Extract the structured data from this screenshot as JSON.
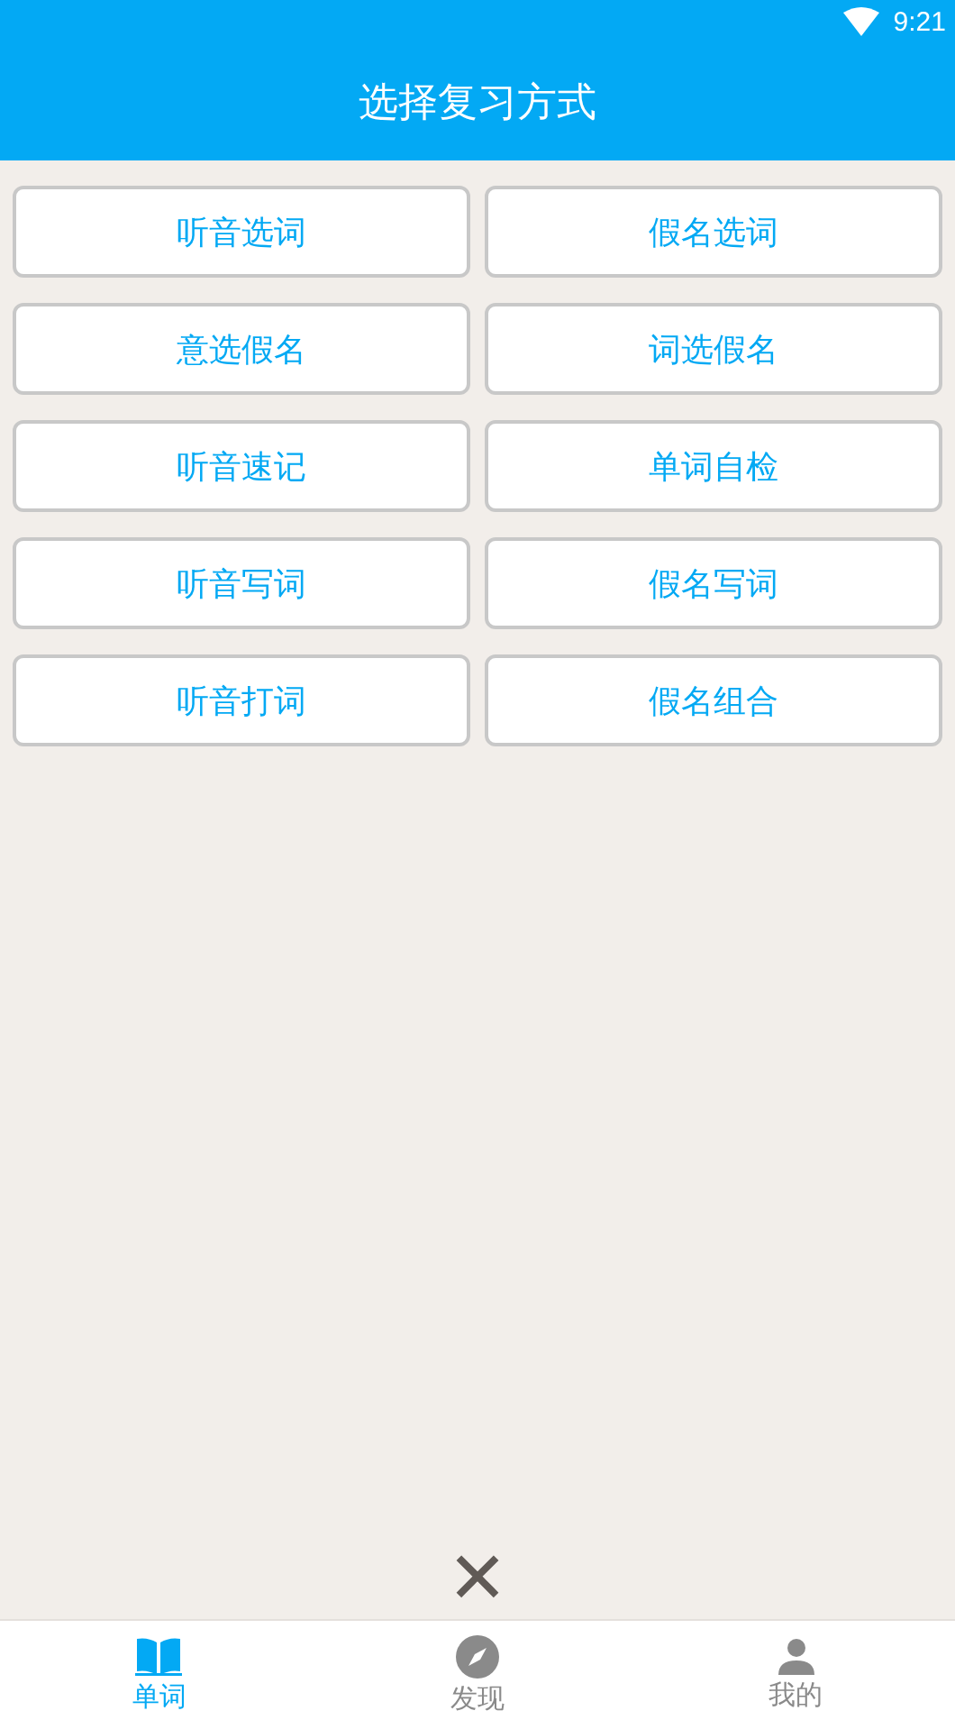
{
  "status_bar": {
    "time": "9:21"
  },
  "header": {
    "title": "选择复习方式"
  },
  "modes": [
    "听音选词",
    "假名选词",
    "意选假名",
    "词选假名",
    "听音速记",
    "单词自检",
    "听音写词",
    "假名写词",
    "听音打词",
    "假名组合"
  ],
  "close_button": {
    "label": "✕"
  },
  "bottom_nav": [
    {
      "label": "单词",
      "selected": true
    },
    {
      "label": "发现",
      "selected": false
    },
    {
      "label": "我的",
      "selected": false
    }
  ]
}
